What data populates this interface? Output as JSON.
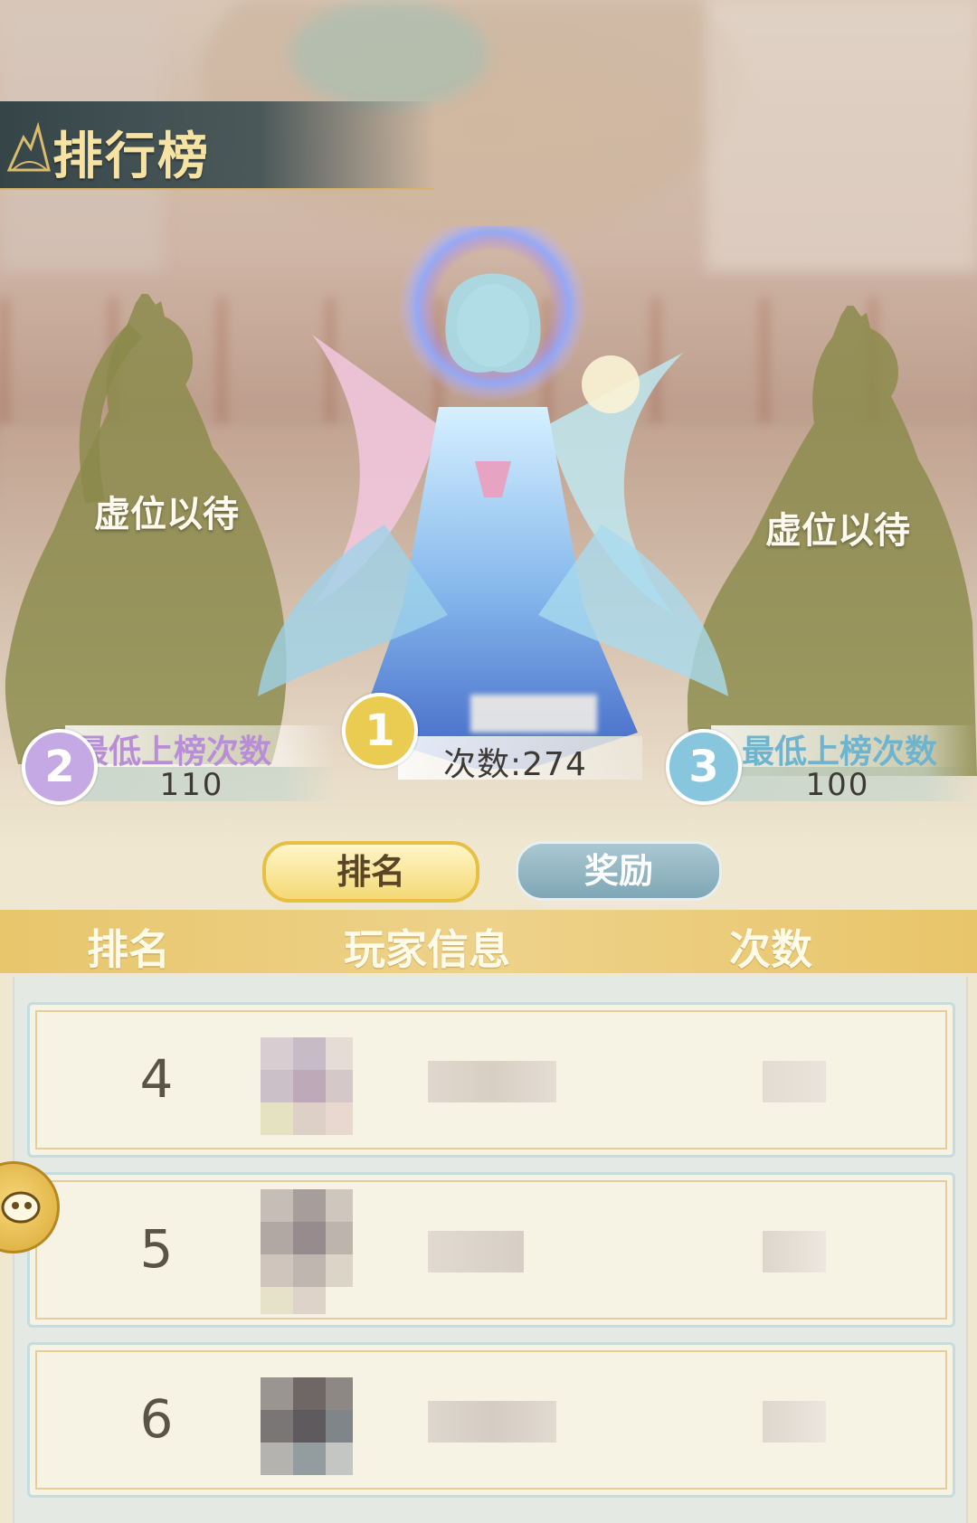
{
  "header": {
    "title": "排行榜"
  },
  "podium": {
    "second": {
      "rank": "2",
      "placeholder": "虚位以待",
      "label": "最低上榜次数",
      "value": "110",
      "color": "#b88fd6"
    },
    "first": {
      "rank": "1",
      "count_text": "次数:274",
      "color": "#e9c94c"
    },
    "third": {
      "rank": "3",
      "placeholder": "虚位以待",
      "label": "最低上榜次数",
      "value": "100",
      "color": "#6fb4cf"
    }
  },
  "tabs": {
    "rank": "排名",
    "reward": "奖励"
  },
  "table": {
    "columns": [
      "排名",
      "玩家信息",
      "次数"
    ],
    "rows": [
      {
        "rank": "4"
      },
      {
        "rank": "5"
      },
      {
        "rank": "6"
      }
    ]
  },
  "icons": {
    "side_button": "mask-icon",
    "title_deco": "mountain-icon"
  }
}
